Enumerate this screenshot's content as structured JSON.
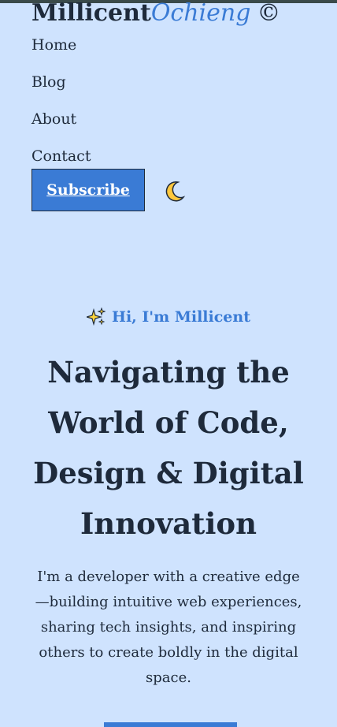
{
  "logo": {
    "first": "Millicent",
    "last": "Ochieng",
    "mark": "©"
  },
  "nav": {
    "items": [
      {
        "label": "Home"
      },
      {
        "label": "Blog"
      },
      {
        "label": "About"
      },
      {
        "label": "Contact"
      }
    ]
  },
  "header": {
    "subscribe_label": "Subscribe",
    "theme_icon": "moon-icon"
  },
  "hero": {
    "eyebrow": "Hi, I'm Millicent",
    "eyebrow_icon": "sparkles-icon",
    "title": "Navigating the World of Code, Design & Digital Innovation",
    "description": "I'm a developer with a creative edge—building intuitive web experiences, sharing tech insights, and inspiring others to create boldly in the digital space."
  },
  "colors": {
    "background": "#cfe3fe",
    "accent": "#3a7bd5",
    "text": "#1e2a3b"
  }
}
